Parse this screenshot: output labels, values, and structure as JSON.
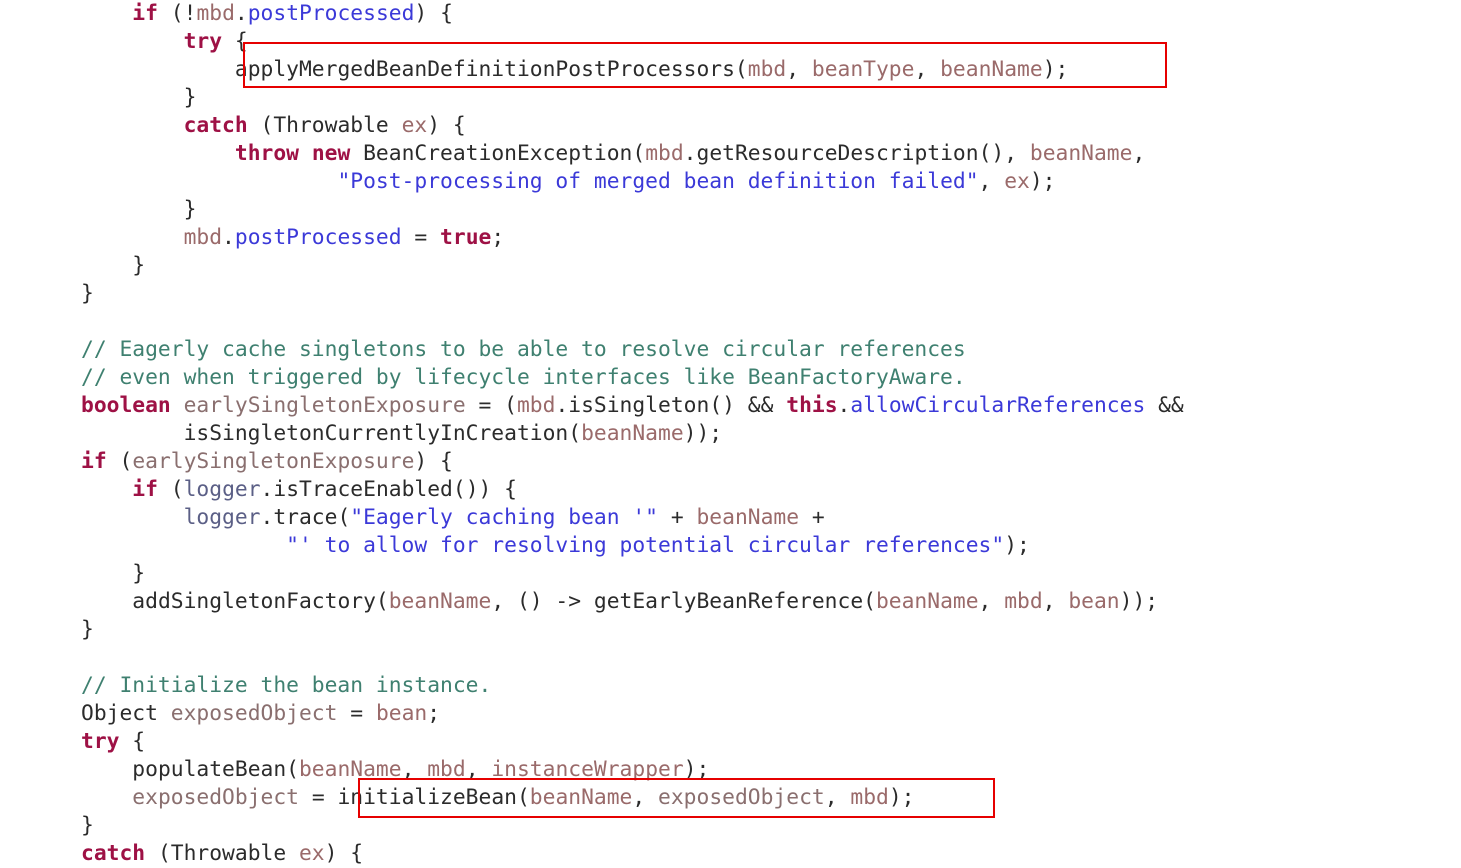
{
  "document": {
    "kind": "source-code-listing",
    "language": "java",
    "font_size_px": 21,
    "line_height_px": 28,
    "colors": {
      "background": "#ffffff",
      "keyword": "#9e1145",
      "comment": "#3f8070",
      "string": "#3b39d8",
      "field": "#3b39d8",
      "parameter": "#9a6a6a",
      "local_variable": "#8a6f6f",
      "plain_text": "#2b2b2b",
      "highlight_box": "#e60000"
    }
  },
  "code": {
    "lines": [
      "    if (!mbd.postProcessed) {",
      "        try {",
      "            applyMergedBeanDefinitionPostProcessors(mbd, beanType, beanName);",
      "        }",
      "        catch (Throwable ex) {",
      "            throw new BeanCreationException(mbd.getResourceDescription(), beanName,",
      "                    \"Post-processing of merged bean definition failed\", ex);",
      "        }",
      "        mbd.postProcessed = true;",
      "    }",
      "}",
      "",
      "// Eagerly cache singletons to be able to resolve circular references",
      "// even when triggered by lifecycle interfaces like BeanFactoryAware.",
      "boolean earlySingletonExposure = (mbd.isSingleton() && this.allowCircularReferences &&",
      "        isSingletonCurrentlyInCreation(beanName));",
      "if (earlySingletonExposure) {",
      "    if (logger.isTraceEnabled()) {",
      "        logger.trace(\"Eagerly caching bean '\" + beanName +",
      "                \"' to allow for resolving potential circular references\");",
      "    }",
      "    addSingletonFactory(beanName, () -> getEarlyBeanReference(beanName, mbd, bean));",
      "}",
      "",
      "// Initialize the bean instance.",
      "Object exposedObject = bean;",
      "try {",
      "    populateBean(beanName, mbd, instanceWrapper);",
      "    exposedObject = initializeBean(beanName, exposedObject, mbd);",
      "}",
      "catch (Throwable ex) {"
    ]
  },
  "highlights": [
    {
      "name": "apply-merged-bean-definition-post-processors",
      "text": "applyMergedBeanDefinitionPostProcessors(mbd, beanType, beanName);",
      "color": "#e60000"
    },
    {
      "name": "initialize-bean",
      "text": "initializeBean(beanName, exposedObject, mbd);",
      "color": "#e60000"
    }
  ]
}
